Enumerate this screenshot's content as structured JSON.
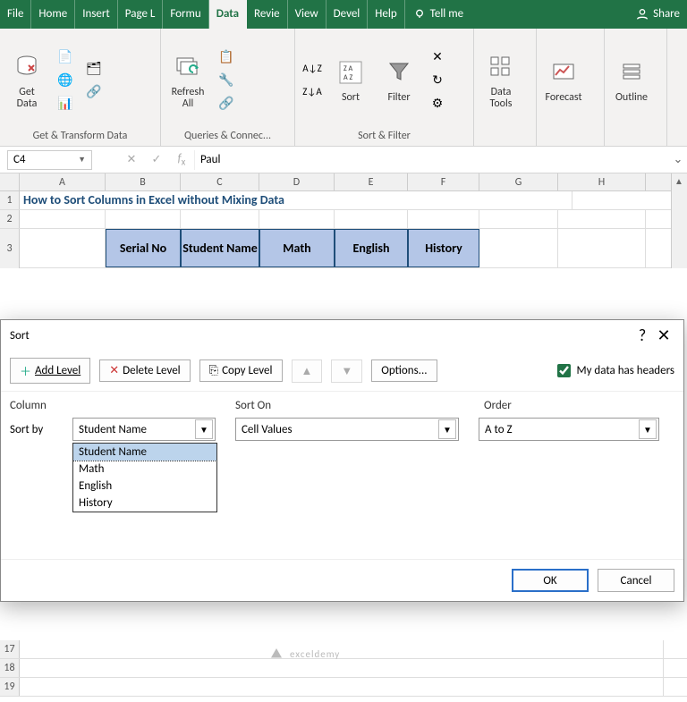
{
  "tabs": {
    "file": "File",
    "home": "Home",
    "insert": "Insert",
    "pagel": "Page L",
    "formu": "Formu",
    "data": "Data",
    "revie": "Revie",
    "view": "View",
    "devel": "Devel",
    "help": "Help",
    "tellme": "Tell me",
    "share": "Share"
  },
  "ribbon": {
    "getdata": "Get\nData",
    "refresh": "Refresh\nAll",
    "sort": "Sort",
    "filter": "Filter",
    "datatools": "Data\nTools",
    "forecast": "Forecast",
    "outline": "Outline",
    "g1": "Get & Transform Data",
    "g2": "Queries & Connec...",
    "g3": "Sort & Filter"
  },
  "namebox": "C4",
  "formula_value": "Paul",
  "cols": [
    "A",
    "B",
    "C",
    "D",
    "E",
    "F",
    "G",
    "H"
  ],
  "rows_visible": [
    "1",
    "2",
    "3"
  ],
  "title_text": "How to Sort Columns in Excel without Mixing Data",
  "headers": [
    "Serial No",
    "Student Name",
    "Math",
    "English",
    "History"
  ],
  "bottom_rows": [
    "17",
    "18",
    "19"
  ],
  "dialog": {
    "title": "Sort",
    "add": "Add Level",
    "del": "Delete Level",
    "copy": "Copy Level",
    "options": "Options...",
    "headers_chk": "My data has headers",
    "col_h1": "Column",
    "col_h2": "Sort On",
    "col_h3": "Order",
    "sortby": "Sort by",
    "combo1": "Student Name",
    "combo2": "Cell Values",
    "combo3": "A to Z",
    "opts": [
      "Student Name",
      "Math",
      "English",
      "History"
    ],
    "ok": "OK",
    "cancel": "Cancel"
  },
  "watermark": "exceldemy"
}
